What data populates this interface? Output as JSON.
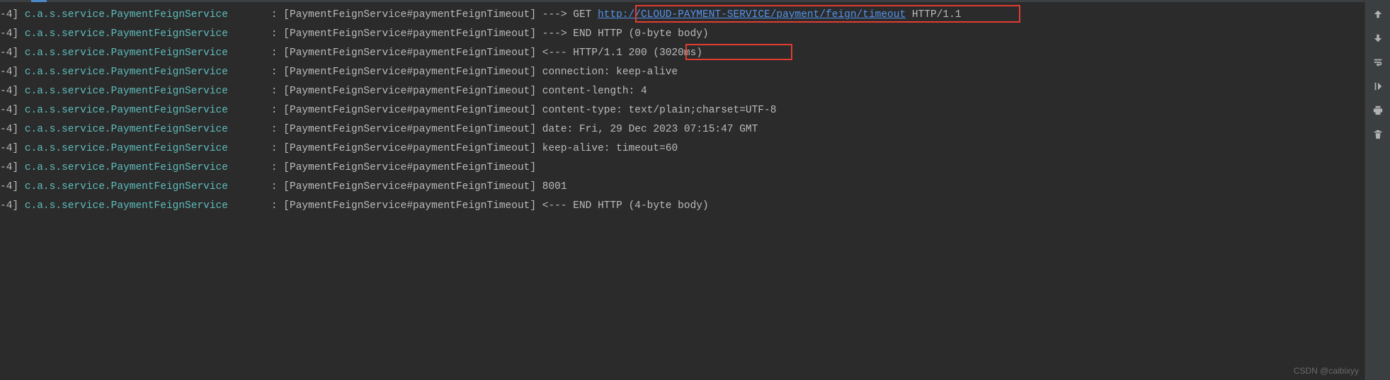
{
  "watermark": "CSDN @caibixyy",
  "url": "http://CLOUD-PAYMENT-SERVICE/payment/feign/timeout",
  "lines": [
    {
      "thread": "-4]",
      "logger": "c.a.s.service.PaymentFeignService",
      "sep": "       :",
      "prefix": " [PaymentFeignService#paymentFeignTimeout] ---> GET ",
      "hasLink": true,
      "suffix": " HTTP/1.1"
    },
    {
      "thread": "-4]",
      "logger": "c.a.s.service.PaymentFeignService",
      "sep": "       :",
      "prefix": " [PaymentFeignService#paymentFeignTimeout] ---> END HTTP (0-byte body)",
      "hasLink": false,
      "suffix": ""
    },
    {
      "thread": "-4]",
      "logger": "c.a.s.service.PaymentFeignService",
      "sep": "       :",
      "prefix": " [PaymentFeignService#paymentFeignTimeout] <--- HTTP/1.1 200 (3020ms)",
      "hasLink": false,
      "suffix": ""
    },
    {
      "thread": "-4]",
      "logger": "c.a.s.service.PaymentFeignService",
      "sep": "       :",
      "prefix": " [PaymentFeignService#paymentFeignTimeout] connection: keep-alive",
      "hasLink": false,
      "suffix": ""
    },
    {
      "thread": "-4]",
      "logger": "c.a.s.service.PaymentFeignService",
      "sep": "       :",
      "prefix": " [PaymentFeignService#paymentFeignTimeout] content-length: 4",
      "hasLink": false,
      "suffix": ""
    },
    {
      "thread": "-4]",
      "logger": "c.a.s.service.PaymentFeignService",
      "sep": "       :",
      "prefix": " [PaymentFeignService#paymentFeignTimeout] content-type: text/plain;charset=UTF-8",
      "hasLink": false,
      "suffix": ""
    },
    {
      "thread": "-4]",
      "logger": "c.a.s.service.PaymentFeignService",
      "sep": "       :",
      "prefix": " [PaymentFeignService#paymentFeignTimeout] date: Fri, 29 Dec 2023 07:15:47 GMT",
      "hasLink": false,
      "suffix": ""
    },
    {
      "thread": "-4]",
      "logger": "c.a.s.service.PaymentFeignService",
      "sep": "       :",
      "prefix": " [PaymentFeignService#paymentFeignTimeout] keep-alive: timeout=60",
      "hasLink": false,
      "suffix": ""
    },
    {
      "thread": "-4]",
      "logger": "c.a.s.service.PaymentFeignService",
      "sep": "       :",
      "prefix": " [PaymentFeignService#paymentFeignTimeout] ",
      "hasLink": false,
      "suffix": ""
    },
    {
      "thread": "-4]",
      "logger": "c.a.s.service.PaymentFeignService",
      "sep": "       :",
      "prefix": " [PaymentFeignService#paymentFeignTimeout] 8001",
      "hasLink": false,
      "suffix": ""
    },
    {
      "thread": "-4]",
      "logger": "c.a.s.service.PaymentFeignService",
      "sep": "       :",
      "prefix": " [PaymentFeignService#paymentFeignTimeout] <--- END HTTP (4-byte body)",
      "hasLink": false,
      "suffix": ""
    }
  ]
}
